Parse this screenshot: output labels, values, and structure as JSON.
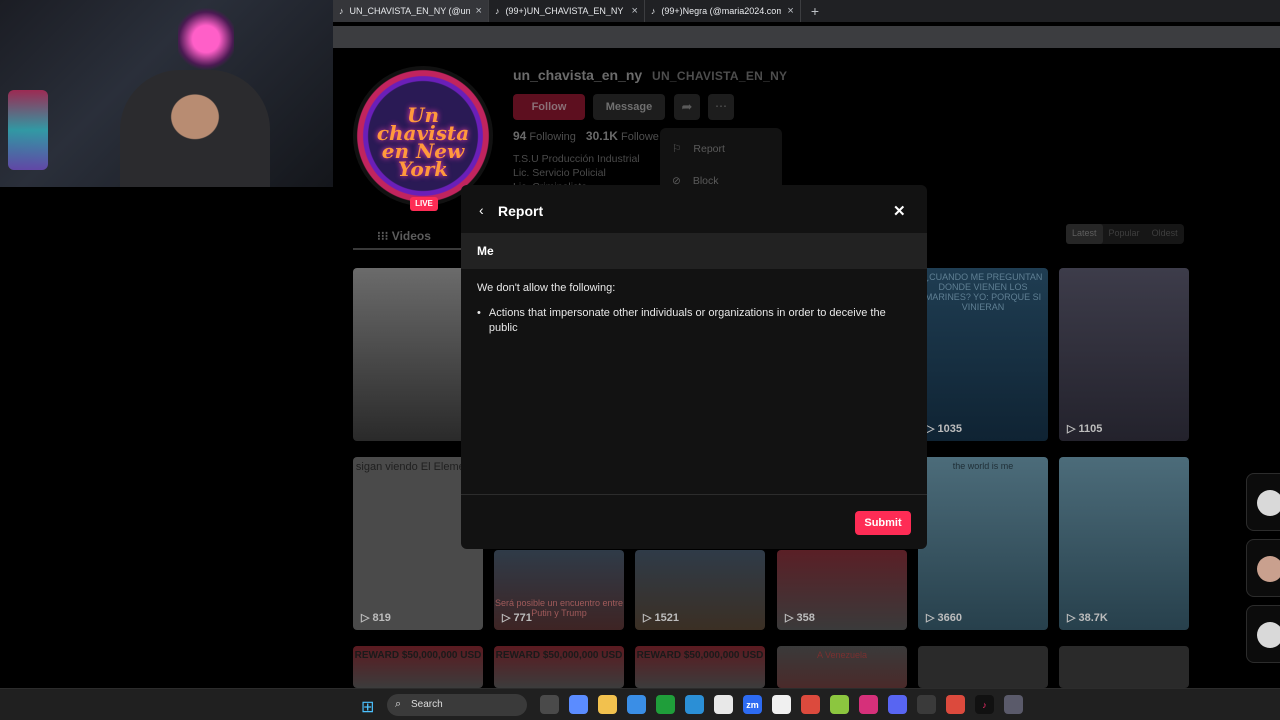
{
  "browser": {
    "tabs": [
      {
        "title": "UN_CHAVISTA_EN_NY (@un_chav",
        "active": true
      },
      {
        "title": "(99+)UN_CHAVISTA_EN_NY (@un",
        "active": false
      },
      {
        "title": "(99+)Negra (@maria2024.com2)",
        "active": false
      }
    ],
    "new_tab": "+",
    "close_glyph": "×",
    "tab_icon": "tiktok-icon"
  },
  "profile": {
    "username": "un_chavista_en_ny",
    "nickname": "UN_CHAVISTA_EN_NY",
    "avatar_text": "Un chavista en New York",
    "live_badge": "LIVE",
    "follow_label": "Follow",
    "message_label": "Message",
    "following_count": "94",
    "following_label": "Following",
    "followers_count": "30.1K",
    "followers_label": "Followe",
    "bio_lines": [
      "T.S.U Producción Industrial",
      "Lic. Servicio Policial",
      "Lic. Criminalista"
    ]
  },
  "more_menu": {
    "items": [
      {
        "label": "Report",
        "icon": "flag-icon"
      },
      {
        "label": "Block",
        "icon": "block-icon"
      }
    ]
  },
  "content_tabs": {
    "videos_label": "Videos",
    "sort": [
      "Latest",
      "Popular",
      "Oldest"
    ],
    "sort_selected": "Latest"
  },
  "videos": [
    {
      "count": "",
      "caption": ""
    },
    {
      "count": "",
      "caption": ""
    },
    {
      "count": "",
      "caption": ""
    },
    {
      "count": "",
      "caption": ""
    },
    {
      "count": "1035",
      "caption": "¿CUANDO ME PREGUNTAN DONDE VIENEN LOS MARINES? YO: PORQUE SI VINIERAN"
    },
    {
      "count": "1105",
      "caption": ""
    },
    {
      "count": "819",
      "caption": "sigan viendo El Elemento"
    },
    {
      "count": "771",
      "caption": "Será posible un encuentro entre Putin y Trump"
    },
    {
      "count": "1521",
      "caption": ""
    },
    {
      "count": "358",
      "caption": ""
    },
    {
      "count": "3660",
      "caption": "the world is me"
    },
    {
      "count": "38.7K",
      "caption": ""
    },
    {
      "count": "",
      "caption": "REWARD $50,000,000 USD"
    },
    {
      "count": "",
      "caption": "REWARD $50,000,000 USD"
    },
    {
      "count": "",
      "caption": "REWARD $50,000,000 USD"
    },
    {
      "count": "",
      "caption": "A Venezuela"
    },
    {
      "count": "",
      "caption": ""
    },
    {
      "count": "",
      "caption": ""
    }
  ],
  "modal": {
    "title": "Report",
    "back_icon": "chevron-left-icon",
    "close_icon": "close-icon",
    "reason": "Me",
    "intro": "We don't allow the following:",
    "rules": [
      "Actions that impersonate other individuals or organizations in order to deceive the public"
    ],
    "submit_label": "Submit"
  },
  "taskbar": {
    "search_label": "Search",
    "apps": [
      "task-view",
      "copilot",
      "file-explorer",
      "store",
      "xbox",
      "edge",
      "notepad",
      "zoom",
      "capcut",
      "chrome",
      "vpn",
      "instagram",
      "discord",
      "steam",
      "chrome-2",
      "tiktok",
      "obs"
    ]
  },
  "colors": {
    "accent": "#fe2c55",
    "modal_bg": "#121212",
    "page_bg": "#000000"
  }
}
